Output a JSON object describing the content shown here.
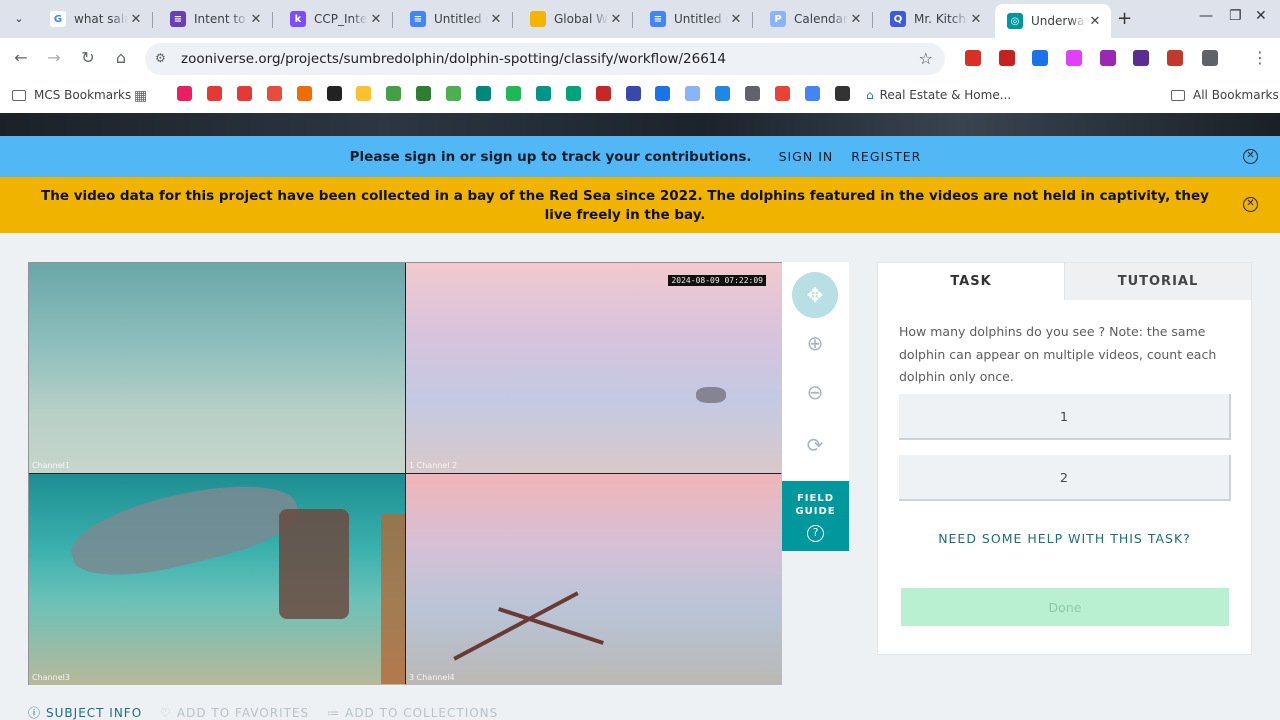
{
  "browser": {
    "tabs": [
      {
        "label": "what salary",
        "favicon": "google-icon",
        "color": "#ffffff",
        "glyph": "G",
        "glyph_color": "#4285f4"
      },
      {
        "label": "Intent to P",
        "favicon": "form-icon",
        "color": "#6a3fb5",
        "glyph": "≡",
        "glyph_color": "#ffffff"
      },
      {
        "label": "CCP_Inten",
        "favicon": "k-icon",
        "color": "#7c4dff",
        "glyph": "k",
        "glyph_color": "#ffffff"
      },
      {
        "label": "Untitled do",
        "favicon": "docs-icon",
        "color": "#4285f4",
        "glyph": "≡",
        "glyph_color": "#ffffff"
      },
      {
        "label": "Global Wa",
        "favicon": "slides-icon",
        "color": "#f4b400",
        "glyph": "",
        "glyph_color": "#ffffff"
      },
      {
        "label": "Untitled do",
        "favicon": "docs-icon",
        "color": "#4285f4",
        "glyph": "≡",
        "glyph_color": "#ffffff"
      },
      {
        "label": "Calendar |",
        "favicon": "p-icon",
        "color": "#8ab4f8",
        "glyph": "P",
        "glyph_color": "#ffffff"
      },
      {
        "label": "Mr. Kitche",
        "favicon": "q-icon",
        "color": "#3b5bdb",
        "glyph": "Q",
        "glyph_color": "#ffffff"
      },
      {
        "label": "Underwate",
        "favicon": "zooniverse-icon",
        "color": "#00979d",
        "glyph": "◎",
        "glyph_color": "#ffffff"
      }
    ],
    "url": "zooniverse.org/projects/sumbredolphin/dolphin-spotting/classify/workflow/26614",
    "bookmarks": {
      "folder_label": "MCS Bookmarks",
      "all_label": "All Bookmarks",
      "named_item": "Real Estate & Home...",
      "icon_colors": [
        "#e91e63",
        "#e53935",
        "#e53935",
        "#e74c3c",
        "#ef6c00",
        "#222222",
        "#fbc02d",
        "#43a047",
        "#2e7d32",
        "#4caf50",
        "#00897b",
        "#1db954",
        "#009688",
        "#00a37a",
        "#c62828",
        "#3949ab",
        "#1a73e8",
        "#8ab4f8",
        "#1e88e5",
        "#5f6368",
        "#ea4335",
        "#4285f4",
        "#333333"
      ]
    },
    "extension_colors": [
      "#d93025",
      "#c5221f",
      "#1a73e8",
      "#e040fb",
      "#9c27b0",
      "#5b2d90",
      "#c0392b",
      "#5f6368"
    ]
  },
  "page": {
    "signin_text": "Please sign in or sign up to track your contributions.",
    "signin_link": "SIGN IN",
    "register_link": "REGISTER",
    "info_text": "The video data for this project have been collected in a bay of the Red Sea since 2022. The dolphins featured in the videos are not held in captivity, they live freely in the bay.",
    "viewer": {
      "timestamp": "2024-08-09 07:22:09",
      "cam_labels": [
        "Channel1",
        "1 Channel 2",
        "Channel3",
        "3 Channel4"
      ]
    },
    "field_guide_label": "FIELD GUIDE",
    "task": {
      "tab_task": "TASK",
      "tab_tutorial": "TUTORIAL",
      "question": "How many dolphins do you see ? Note: the same dolphin can appear on multiple videos, count each dolphin only once.",
      "answers": [
        "1",
        "2"
      ],
      "help_link": "NEED SOME HELP WITH THIS TASK?",
      "done_label": "Done"
    },
    "subject_actions": {
      "info": "SUBJECT INFO",
      "favorites": "ADD TO FAVORITES",
      "collections": "ADD TO COLLECTIONS"
    }
  }
}
